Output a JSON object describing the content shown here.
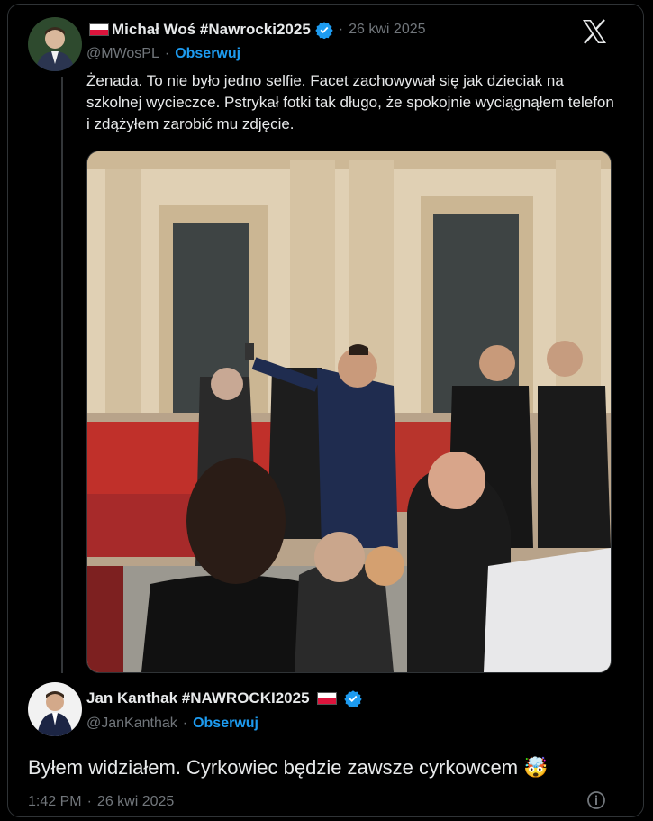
{
  "tweet": {
    "author_name": "Michał Woś #Nawrocki2025",
    "separator": "·",
    "date": "26 kwi 2025",
    "handle": "@MWosPL",
    "follow_label": "Obserwuj",
    "text": "Żenada. To nie było jedno selfie. Facet zachowywał się jak dzieciak na szkolnej wycieczce. Pstrykał fotki tak długo, że spokojnie wyciągnąłem telefon i zdążyłem zarobić mu zdjęcie."
  },
  "reply": {
    "author_name": "Jan Kanthak #NAWROCKI2025",
    "handle": "@JanKanthak",
    "separator": "·",
    "follow_label": "Obserwuj",
    "text": "Byłem widziałem. Cyrkowiec będzie zawsze cyrkowcem 🤯",
    "time": "1:42 PM",
    "date": "26 kwi 2025"
  },
  "icons": [
    "x-logo-icon",
    "verified-badge-icon",
    "poland-flag-icon",
    "info-icon"
  ],
  "colors": {
    "background": "#000000",
    "text": "#e7e9ea",
    "muted": "#71767b",
    "accent": "#1d9bf0"
  }
}
